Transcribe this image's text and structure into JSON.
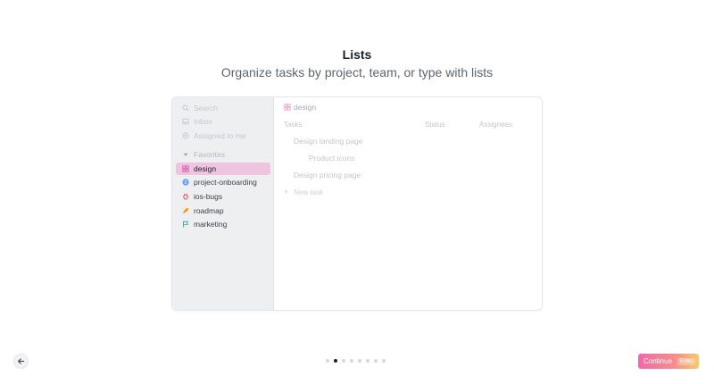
{
  "header": {
    "title": "Lists",
    "subtitle": "Organize tasks by project, team, or type with lists"
  },
  "sidebar": {
    "search": "Search",
    "inbox": "Inbox",
    "assigned": "Assigned to me",
    "favorites_label": "Favorites",
    "items": [
      {
        "label": "design",
        "icon": "design-list-icon",
        "color": "#e24fa5",
        "active": true
      },
      {
        "label": "project-onboarding",
        "icon": "globe-icon",
        "color": "#3b82f6",
        "active": false
      },
      {
        "label": "ios-bugs",
        "icon": "bug-icon",
        "color": "#e5484d",
        "active": false
      },
      {
        "label": "roadmap",
        "icon": "rocket-icon",
        "color": "#f59e0b",
        "active": false
      },
      {
        "label": "marketing",
        "icon": "flag-icon",
        "color": "#14b8a6",
        "active": false
      }
    ]
  },
  "main": {
    "list_title": "design",
    "columns": {
      "tasks": "Tasks",
      "status": "Status",
      "assignees": "Assignees"
    },
    "tasks": [
      {
        "label": "Design landing page"
      },
      {
        "label": "Product icons"
      },
      {
        "label": "Design pricing page"
      }
    ],
    "new_task": "New task"
  },
  "footer": {
    "continue_label": "Continue",
    "continue_key": "Enter",
    "page_count": 8,
    "current_page": 2
  },
  "colors": {
    "accent_start": "#f06aa6",
    "accent_end": "#f9c96d",
    "active_item_bg": "#efc4df"
  }
}
